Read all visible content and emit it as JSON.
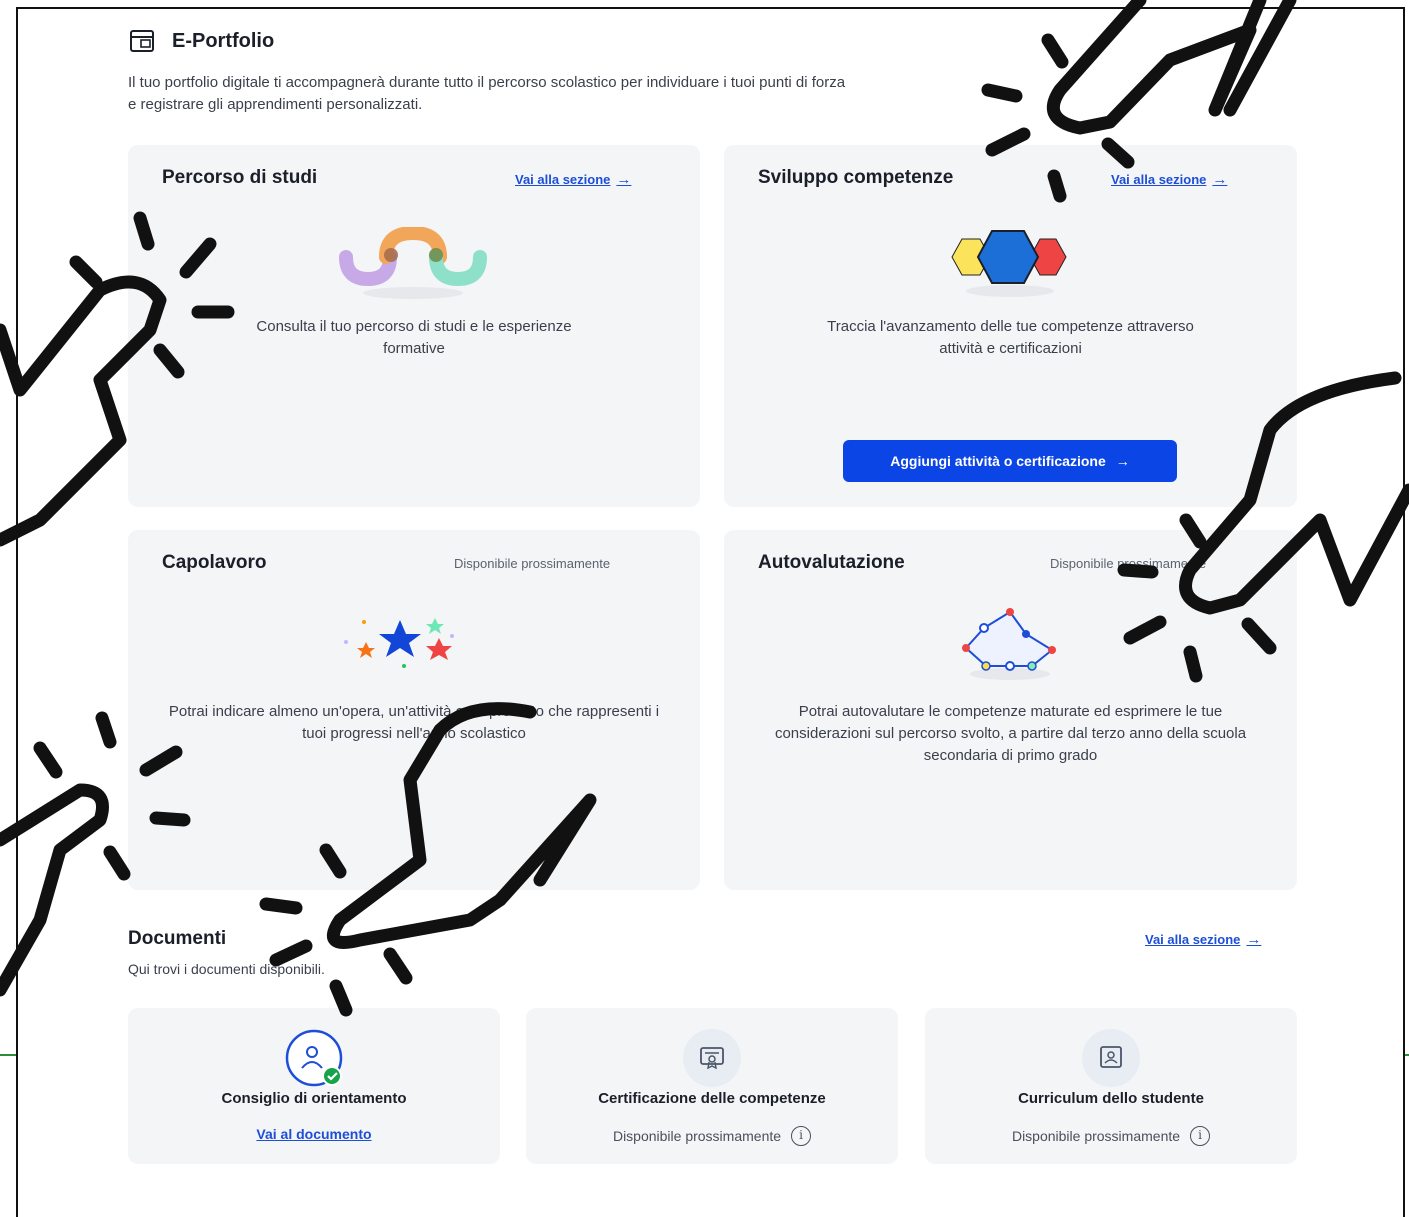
{
  "page": {
    "title": "E-Portfolio",
    "intro": "Il tuo portfolio digitale ti accompagnerà durante tutto il percorso scolastico per individuare i tuoi punti di forza e registrare gli apprendimenti personalizzati.",
    "title_icon": "portfolio-icon"
  },
  "cards": {
    "percorso": {
      "title": "Percorso di studi",
      "link": "Vai alla sezione",
      "description": "Consulta il tuo percorso di studi e le esperienze formative"
    },
    "sviluppo": {
      "title": "Sviluppo competenze",
      "link": "Vai alla sezione",
      "description": "Traccia l'avanzamento delle tue competenze attraverso attività e certificazioni",
      "cta": "Aggiungi attività o certificazione"
    },
    "capolavoro": {
      "title": "Capolavoro",
      "status": "Disponibile prossimamente",
      "description": "Potrai indicare almeno un'opera, un'attività o un prodotto che rappresenti i tuoi progressi nell'anno scolastico"
    },
    "autovalutazione": {
      "title": "Autovalutazione",
      "status": "Disponibile prossimamente",
      "description": "Potrai autovalutare le competenze maturate ed esprimere le tue considerazioni sul percorso svolto, a partire dal terzo anno della scuola secondaria di primo grado"
    }
  },
  "documents": {
    "title": "Documenti",
    "subtitle": "Qui trovi i documenti disponibili.",
    "link": "Vai alla sezione",
    "items": [
      {
        "name": "Consiglio di orientamento",
        "link": "Vai al documento",
        "icon": "orientation-check-icon"
      },
      {
        "name": "Certificazione delle competenze",
        "status": "Disponibile prossimamente",
        "icon": "certificate-icon"
      },
      {
        "name": "Curriculum dello studente",
        "status": "Disponibile prossimamente",
        "icon": "curriculum-icon"
      }
    ]
  },
  "arrow": "→",
  "info_glyph": "i",
  "colors": {
    "accent": "#0b45e6",
    "link": "#1d4ed8",
    "card_bg": "#f4f5f7",
    "success": "#16a34a"
  }
}
